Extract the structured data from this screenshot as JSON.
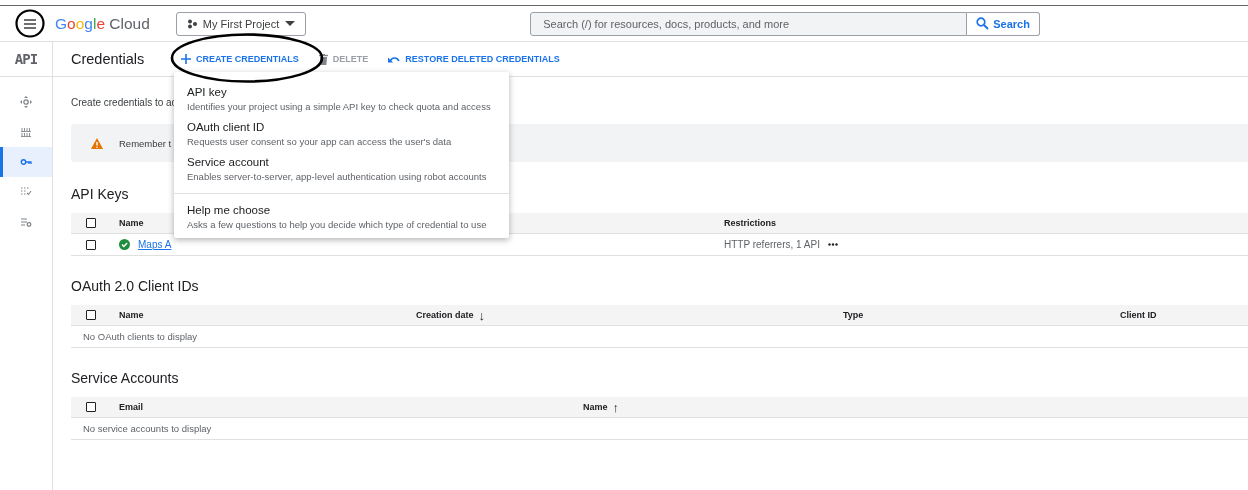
{
  "header": {
    "logo": "Google Cloud",
    "project": "My First Project",
    "search": {
      "placeholder": "Search (/) for resources, docs, products, and more",
      "button": "Search"
    }
  },
  "rail": {
    "title": "API",
    "items": [
      {
        "selected": false
      },
      {
        "selected": false
      },
      {
        "selected": true
      },
      {
        "selected": false
      },
      {
        "selected": false
      }
    ]
  },
  "toolbar": {
    "title": "Credentials",
    "actions": [
      {
        "label": "CREATE CREDENTIALS",
        "kind": "create",
        "disabled": false
      },
      {
        "label": "DELETE",
        "kind": "delete",
        "disabled": true
      },
      {
        "label": "RESTORE DELETED CREDENTIALS",
        "kind": "restore",
        "disabled": false
      }
    ]
  },
  "description": "Create credentials to ac",
  "banner": {
    "text": "Remember t"
  },
  "sections": [
    {
      "title": "API Keys",
      "select_all": {
        "checked": false
      },
      "columns": [
        {
          "label": "Name"
        },
        {
          "label": "Restrictions"
        }
      ],
      "rows": [
        {
          "checked": false,
          "name": "Maps A",
          "restrictions": "HTTP referrers, 1 API"
        }
      ]
    },
    {
      "title": "OAuth 2.0 Client IDs",
      "select_all": {
        "checked": false
      },
      "columns": [
        {
          "label": "Name"
        },
        {
          "label": "Creation date",
          "sort_icon": "↓"
        },
        {
          "label": "Type"
        },
        {
          "label": "Client ID"
        }
      ],
      "empty_text": "No OAuth clients to display"
    },
    {
      "title": "Service Accounts",
      "select_all": {
        "checked": false
      },
      "columns": [
        {
          "label": "Email"
        },
        {
          "label": "Name",
          "sort_icon": "↑"
        }
      ],
      "empty_text": "No service accounts to display"
    }
  ],
  "menu": {
    "items": [
      {
        "title": "API key",
        "description": "Identifies your project using a simple API key to check quota and access",
        "divider_before": false
      },
      {
        "title": "OAuth client ID",
        "description": "Requests user consent so your app can access the user's data",
        "divider_before": false
      },
      {
        "title": "Service account",
        "description": "Enables server-to-server, app-level authentication using robot accounts",
        "divider_before": false
      },
      {
        "title": "Help me choose",
        "description": "Asks a few questions to help you decide which type of credential to use",
        "divider_before": true
      }
    ]
  }
}
